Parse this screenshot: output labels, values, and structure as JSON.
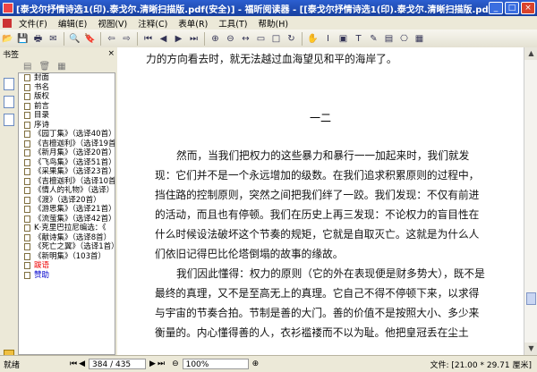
{
  "window": {
    "title": "[泰戈尔抒情诗选1(印).泰戈尔.清晰扫描版.pdf(安全)] - 福昕阅读器 - [[泰戈尔抒情诗选1(印).泰戈尔.清晰扫描版.pdf(安全)]",
    "min_label": "_",
    "max_label": "□",
    "close_label": "×"
  },
  "menu": [
    "文件(F)",
    "编辑(E)",
    "视图(V)",
    "注释(C)",
    "表单(R)",
    "工具(T)",
    "帮助(H)"
  ],
  "sidebar": {
    "title": "书签",
    "close_label": "×",
    "bookmarks": [
      {
        "label": "封面",
        "style": "normal"
      },
      {
        "label": "书名",
        "style": "normal"
      },
      {
        "label": "版权",
        "style": "normal"
      },
      {
        "label": "前言",
        "style": "normal"
      },
      {
        "label": "目录",
        "style": "normal"
      },
      {
        "label": "序诗",
        "style": "normal"
      },
      {
        "label": "《园丁集》（选译40首）",
        "style": "normal"
      },
      {
        "label": "《吉檀迦利》（选译19首）",
        "style": "normal"
      },
      {
        "label": "《新月集》（选译20首）",
        "style": "normal"
      },
      {
        "label": "《飞鸟集》（选译51首）",
        "style": "normal"
      },
      {
        "label": "《采果集》（选译23首）",
        "style": "normal"
      },
      {
        "label": "《吉檀迦利》（选译10首）",
        "style": "normal"
      },
      {
        "label": "《情人的礼物》（选译）",
        "style": "normal"
      },
      {
        "label": "《渡》（选译20首）",
        "style": "normal"
      },
      {
        "label": "《游思集》（选译21首）",
        "style": "normal"
      },
      {
        "label": "《流萤集》（选译42首）",
        "style": "normal"
      },
      {
        "label": "K·克里巴拉尼编选：《",
        "style": "normal"
      },
      {
        "label": "《献诗集》（选译8首）",
        "style": "normal"
      },
      {
        "label": "《死亡之翼》（选译1首）",
        "style": "normal"
      },
      {
        "label": "《新明集》（103首）",
        "style": "normal"
      },
      {
        "label": "跋语",
        "style": "red"
      },
      {
        "label": "赞助",
        "style": "blue"
      }
    ]
  },
  "document": {
    "lines": [
      "力的方向看去时，就无法越过血海望见和平的海岸了。",
      "一二",
      "然而，当我们把权力的这些暴力和暴行一一加起来时，我们就发",
      "现：它们并不是一个永远增加的级数。在我们追求积累原则的过程中，",
      "挡住路的控制原则，突然之间把我们绊了一跤。我们发现：不仅有前进",
      "的活动，而且也有停顿。我们在历史上再三发现：不论权力的盲目性在",
      "什么时候设法破坏这个节奏的规矩，它就是自取灭亡。这就是为什么人",
      "们依旧记得巴比伦塔倒塌的故事的缘故。",
      "我们因此懂得：权力的原则（它的外在表现便是财多势大），既不是",
      "最终的真理，又不是至高无上的真理。它自己不得不停顿下来，以求得",
      "与宇宙的节奏合拍。节制是善的大门。善的价值不是按照大小、多少来",
      "衡量的。内心懂得善的人，衣衫褴褛而不以为耻。他把皇冠丢在尘土"
    ]
  },
  "status": {
    "ready": "就绪",
    "page": "384 / 435",
    "zoom": "100%",
    "docsize": "文件: [21.00 * 29.71 厘米]"
  }
}
